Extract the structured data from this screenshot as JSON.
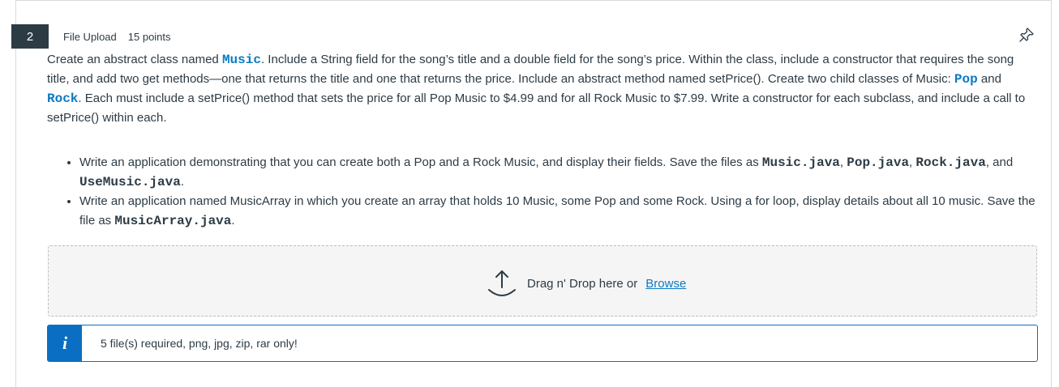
{
  "question": {
    "number": "2",
    "type": "File Upload",
    "points": "15 points"
  },
  "body": {
    "p1_a": "Create an abstract class named ",
    "p1_music": "Music",
    "p1_b": ". Include a String field for the song’s title and a double field for the song’s price. Within the class, include a constructor that requires the song title, and add two get methods—one that returns the title and one that returns the price. Include an abstract method named setPrice(). Create two child classes of Music: ",
    "p1_pop": "Pop",
    "p1_and": " and ",
    "p1_rock": "Rock",
    "p1_c": ". Each must include a setPrice() method that sets the price for all Pop Music to $4.99 and for all Rock Music to $7.99. Write a constructor for each subclass, and include a call to setPrice() within each.",
    "bullet1_a": "Write an application demonstrating that you can create both a Pop and a Rock Music, and display their fields. Save the files as ",
    "bullet1_f1": "Music.java",
    "bullet1_sep1": ", ",
    "bullet1_f2": "Pop.java",
    "bullet1_sep2": ", ",
    "bullet1_f3": "Rock.java",
    "bullet1_and": ", and ",
    "bullet1_f4": "UseMusic.java",
    "bullet1_end": ".",
    "bullet2_a": "Write an application named MusicArray in which you create an array that holds 10 Music, some Pop and some Rock. Using a for loop, display details about all 10 music. Save the file as ",
    "bullet2_f": "MusicArray.java",
    "bullet2_end": "."
  },
  "dropzone": {
    "text": "Drag n' Drop here or",
    "browse": "Browse",
    "icon": "upload-icon"
  },
  "info": {
    "icon_glyph": "i",
    "text": "5 file(s) required, png, jpg, zip, rar only!"
  },
  "colors": {
    "accent": "#0a6fc2",
    "link": "#0b7ac4",
    "badge": "#2d3b45"
  }
}
